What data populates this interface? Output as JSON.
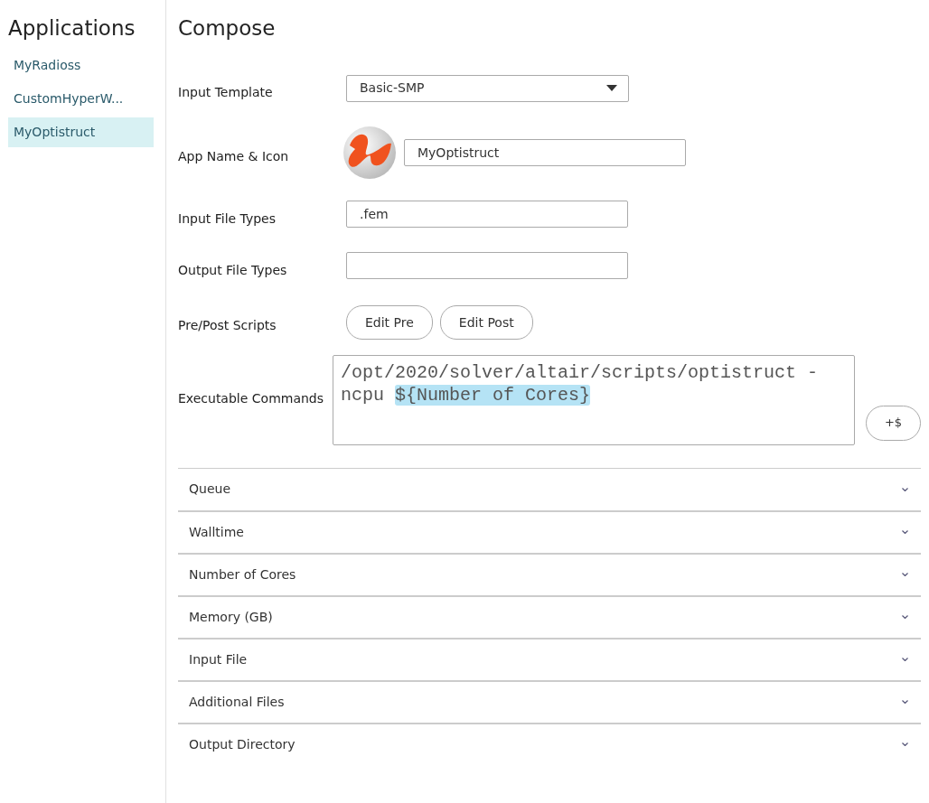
{
  "sidebar": {
    "title": "Applications",
    "items": [
      {
        "label": "MyRadioss",
        "selected": false
      },
      {
        "label": "CustomHyperW...",
        "selected": false
      },
      {
        "label": "MyOptistruct",
        "selected": true
      }
    ]
  },
  "compose": {
    "title": "Compose",
    "fields": [
      {
        "kind": "select",
        "label": "Input Template",
        "value": "Basic-SMP"
      },
      {
        "kind": "icon-text",
        "label": "App Name & Icon",
        "value": "MyOptistruct"
      },
      {
        "kind": "text",
        "label": "Input File Types",
        "value": ".fem"
      },
      {
        "kind": "text",
        "label": "Output File Types"
      },
      {
        "kind": "buttons",
        "label": "Pre/Post Scripts",
        "buttons": [
          "Edit Pre",
          "Edit Post"
        ]
      },
      {
        "kind": "command",
        "label": "Executable Commands",
        "parts": [
          {
            "text": "/opt/2020/solver/altair/scripts/optistruct -ncpu ",
            "highlighted": false
          },
          {
            "text": "${Number of Cores}",
            "highlighted": true
          }
        ],
        "button": "+$"
      }
    ]
  },
  "sections": [
    {
      "label": "Queue",
      "expanded": false
    },
    {
      "label": "Walltime",
      "expanded": false
    },
    {
      "label": "Number of Cores",
      "expanded": false
    },
    {
      "label": "Memory (GB)",
      "expanded": false
    },
    {
      "label": "Input File",
      "expanded": false
    },
    {
      "label": "Additional Files",
      "expanded": false
    },
    {
      "label": "Output Directory",
      "expanded": false
    }
  ]
}
